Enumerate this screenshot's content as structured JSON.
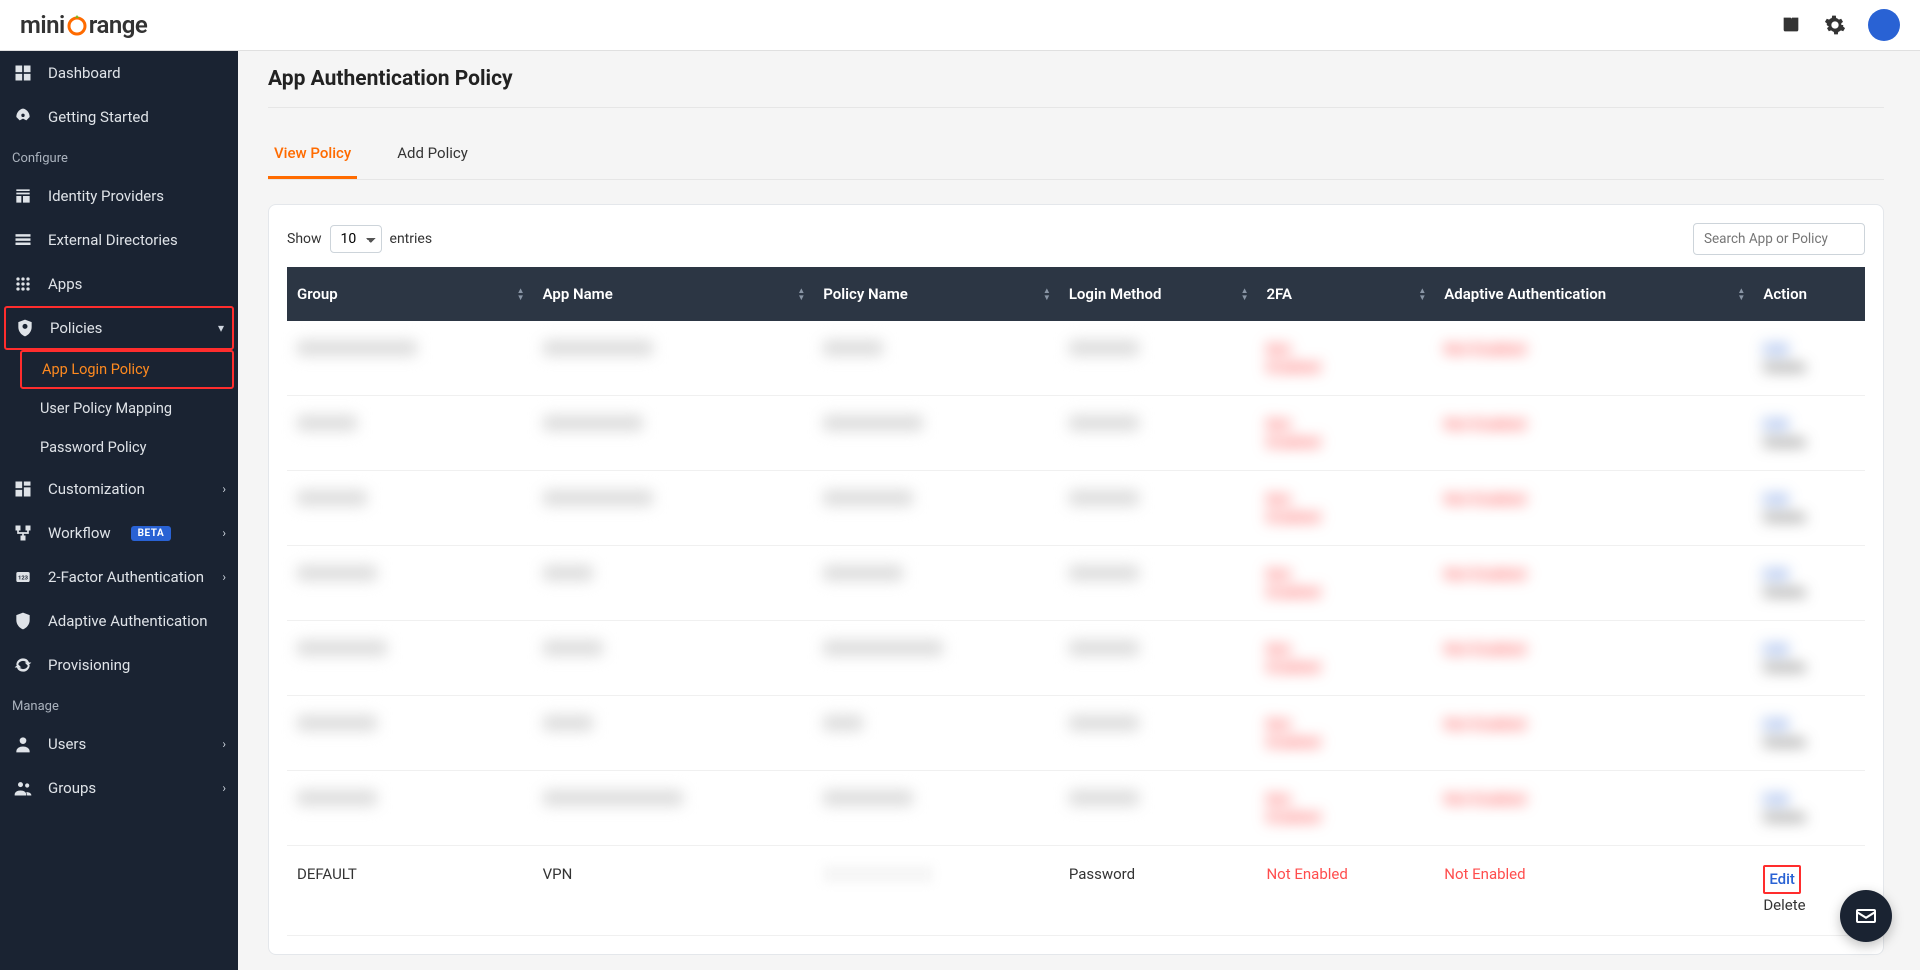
{
  "topbar": {
    "brand_prefix": "mini",
    "brand_suffix": "range"
  },
  "sidebar": {
    "dashboard": "Dashboard",
    "getting_started": "Getting Started",
    "section_configure": "Configure",
    "identity_providers": "Identity Providers",
    "external_directories": "External Directories",
    "apps": "Apps",
    "policies": "Policies",
    "app_login_policy": "App Login Policy",
    "user_policy_mapping": "User Policy Mapping",
    "password_policy": "Password Policy",
    "customization": "Customization",
    "workflow": "Workflow",
    "workflow_badge": "BETA",
    "two_factor": "2-Factor Authentication",
    "adaptive_auth": "Adaptive Authentication",
    "provisioning": "Provisioning",
    "section_manage": "Manage",
    "users": "Users",
    "groups": "Groups"
  },
  "main": {
    "title": "App Authentication Policy",
    "tabs": {
      "view": "View Policy",
      "add": "Add Policy"
    },
    "show_label": "Show",
    "entries_label": "entries",
    "page_size": "10",
    "search_placeholder": "Search App or Policy",
    "columns": {
      "group": "Group",
      "app_name": "App Name",
      "policy_name": "Policy Name",
      "login_method": "Login Method",
      "twofa": "2FA",
      "adaptive": "Adaptive Authentication",
      "action": "Action"
    },
    "last_row": {
      "group": "DEFAULT",
      "app": "VPN",
      "login_method": "Password",
      "twofa": "Not Enabled",
      "adaptive": "Not Enabled",
      "action_edit": "Edit",
      "action_delete": "Delete"
    }
  }
}
